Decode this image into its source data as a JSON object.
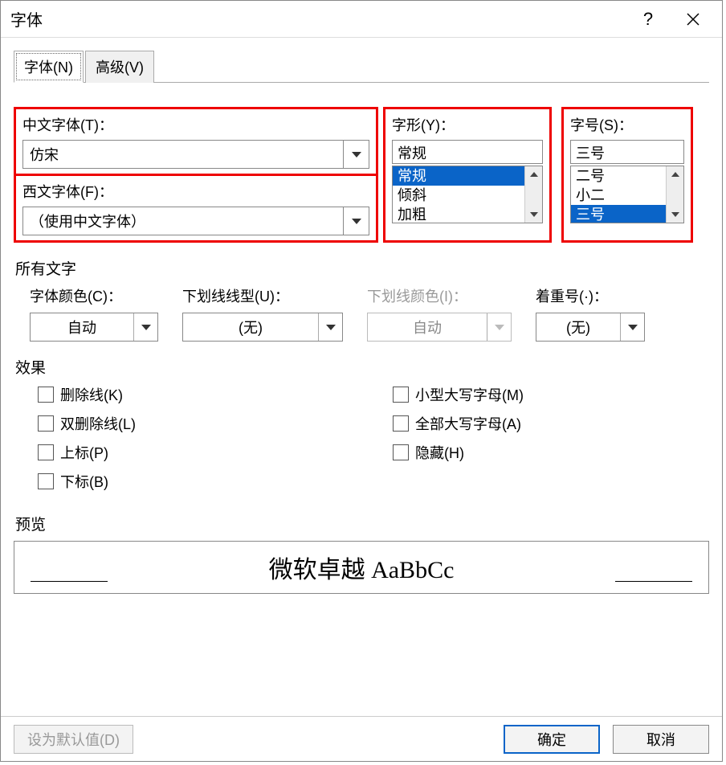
{
  "dialog": {
    "title": "字体"
  },
  "tabs": {
    "font": "字体(N)",
    "advanced": "高级(V)"
  },
  "cnFont": {
    "label": "中文字体(T)：",
    "value": "仿宋"
  },
  "enFont": {
    "label": "西文字体(F)：",
    "value": "（使用中文字体）"
  },
  "style": {
    "label": "字形(Y)：",
    "value": "常规",
    "options": [
      "常规",
      "倾斜",
      "加粗"
    ],
    "selectedIndex": 0
  },
  "size": {
    "label": "字号(S)：",
    "value": "三号",
    "options": [
      "二号",
      "小二",
      "三号"
    ],
    "selectedIndex": 2
  },
  "allText": {
    "heading": "所有文字",
    "color": {
      "label": "字体颜色(C)：",
      "value": "自动"
    },
    "underline": {
      "label": "下划线线型(U)：",
      "value": "(无)"
    },
    "underlineColor": {
      "label": "下划线颜色(I)：",
      "value": "自动"
    },
    "emphasis": {
      "label": "着重号(·)：",
      "value": "(无)"
    }
  },
  "effects": {
    "heading": "效果",
    "strike": "删除线(K)",
    "dblStrike": "双删除线(L)",
    "superscript": "上标(P)",
    "subscript": "下标(B)",
    "smallCaps": "小型大写字母(M)",
    "allCaps": "全部大写字母(A)",
    "hidden": "隐藏(H)"
  },
  "preview": {
    "heading": "预览",
    "sample": "微软卓越  AaBbCc"
  },
  "buttons": {
    "setDefault": "设为默认值(D)",
    "ok": "确定",
    "cancel": "取消"
  }
}
